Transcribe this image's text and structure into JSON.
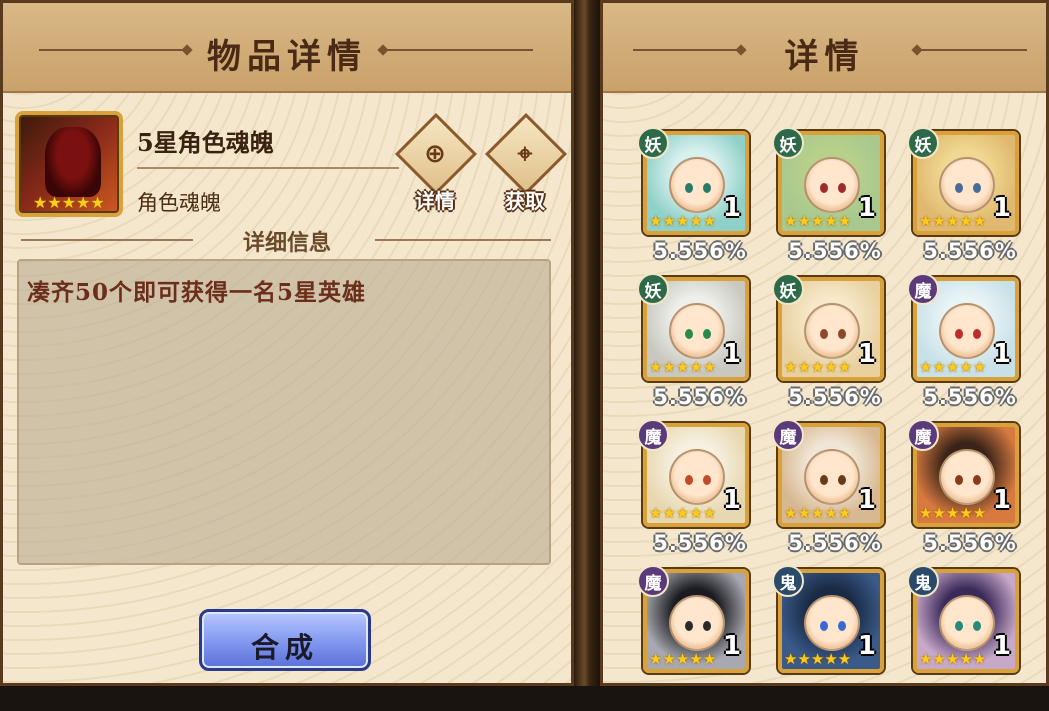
{
  "item_panel": {
    "title": "物品详情",
    "item": {
      "name": "5星角色魂魄",
      "type": "角色魂魄",
      "stars": 5,
      "icon": "hero-soul-silhouette-icon"
    },
    "actions": [
      {
        "label": "详情",
        "icon": "magnify-plus-icon"
      },
      {
        "label": "获取",
        "icon": "map-pin-icon"
      }
    ],
    "section_title": "详细信息",
    "description": "凑齐50个即可获得一名5星英雄",
    "compose_label": "合成"
  },
  "details_panel": {
    "title": "详情",
    "heroes": [
      {
        "faction": "妖",
        "faction_color": "#2e6a4a",
        "count": "1",
        "chance": "5.556%",
        "bg": "#8fd0c8",
        "hair": "#d8f0ee",
        "eye": "#2a7a6a"
      },
      {
        "faction": "妖",
        "faction_color": "#2e6a4a",
        "count": "1",
        "chance": "5.556%",
        "bg": "#a8c890",
        "hair": "#b8d08a",
        "eye": "#a02a2a"
      },
      {
        "faction": "妖",
        "faction_color": "#2e6a4a",
        "count": "1",
        "chance": "5.556%",
        "bg": "#e0b870",
        "hair": "#f0d890",
        "eye": "#4a6a9a"
      },
      {
        "faction": "妖",
        "faction_color": "#2e6a4a",
        "count": "1",
        "chance": "5.556%",
        "bg": "#c8c8c0",
        "hair": "#eeeeea",
        "eye": "#2a8a4a"
      },
      {
        "faction": "妖",
        "faction_color": "#2e6a4a",
        "count": "1",
        "chance": "5.556%",
        "bg": "#e8d0a0",
        "hair": "#f6e8c8",
        "eye": "#8a4a2a"
      },
      {
        "faction": "魔",
        "faction_color": "#5a3a7a",
        "count": "1",
        "chance": "5.556%",
        "bg": "#c8e0e8",
        "hair": "#e8f4f6",
        "eye": "#c02a2a"
      },
      {
        "faction": "魔",
        "faction_color": "#5a3a7a",
        "count": "1",
        "chance": "5.556%",
        "bg": "#e8d8b0",
        "hair": "#f6f0e0",
        "eye": "#c04a2a"
      },
      {
        "faction": "魔",
        "faction_color": "#5a3a7a",
        "count": "1",
        "chance": "5.556%",
        "bg": "#d8b890",
        "hair": "#f0e6d6",
        "eye": "#6a3a1a"
      },
      {
        "faction": "魔",
        "faction_color": "#5a3a7a",
        "count": "1",
        "chance": "5.556%",
        "bg": "#d87a40",
        "hair": "#3a2418",
        "eye": "#8a3a1a"
      },
      {
        "faction": "魔",
        "faction_color": "#5a3a7a",
        "count": "1",
        "chance": "",
        "bg": "#a8a8b0",
        "hair": "#1a1a20",
        "eye": "#2a2a2a"
      },
      {
        "faction": "鬼",
        "faction_color": "#2a4a6a",
        "count": "1",
        "chance": "",
        "bg": "#3a5a8a",
        "hair": "#1a2a44",
        "eye": "#3a6ad0"
      },
      {
        "faction": "鬼",
        "faction_color": "#2a4a6a",
        "count": "1",
        "chance": "",
        "bg": "#c8a8c8",
        "hair": "#3a2a5a",
        "eye": "#2a8a7a"
      }
    ]
  }
}
